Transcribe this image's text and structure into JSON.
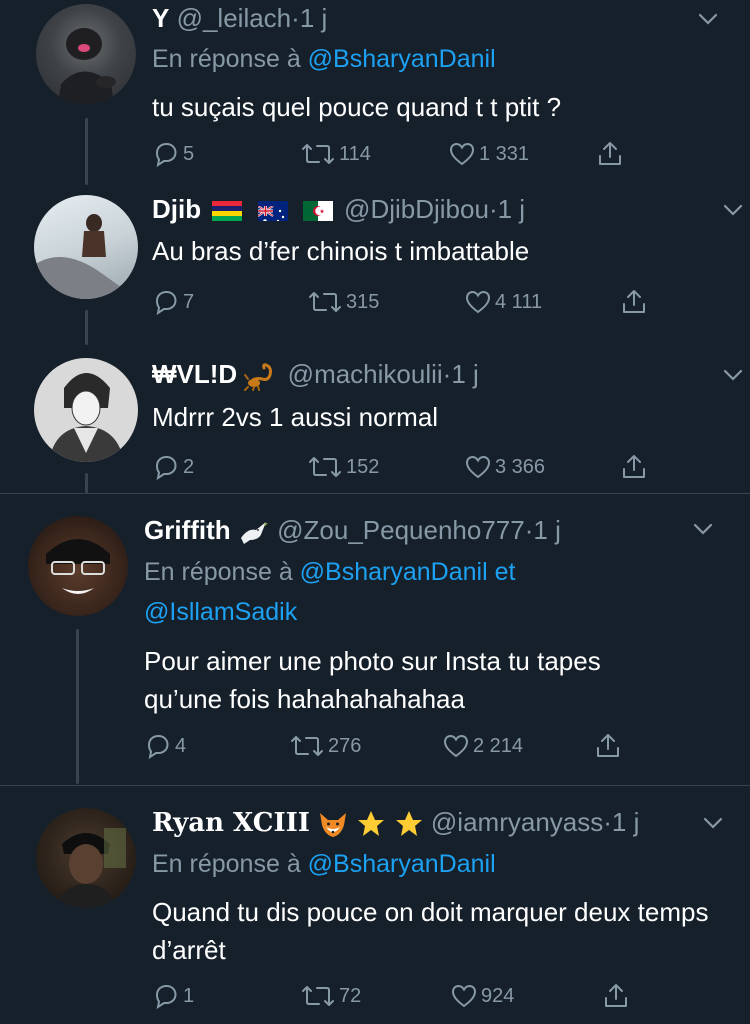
{
  "tweets": [
    {
      "name": "Y",
      "handle": "@_leilach",
      "time": "1 j",
      "reply_prefix": "En réponse à",
      "reply_mention": "@BsharyanDanil",
      "text": "tu suçais quel pouce  quand t t ptit ?",
      "replies": "5",
      "retweets": "114",
      "likes": "1 331"
    },
    {
      "name": "Djib",
      "handle": "@DjibDjibou",
      "time": "1 j",
      "text": "Au bras d’fer chinois t imbattable",
      "replies": "7",
      "retweets": "315",
      "likes": "4 111",
      "flags": [
        "mauritius-flag",
        "australia-flag",
        "algeria-flag"
      ]
    },
    {
      "name": "₩VL!D",
      "handle": "@machikoulii",
      "time": "1 j",
      "text": "Mdrrr 2vs 1 aussi normal",
      "replies": "2",
      "retweets": "152",
      "likes": "3 366",
      "emoji": "scorpion-icon"
    },
    {
      "name": "Griffith",
      "handle": "@Zou_Pequenho777",
      "time": "1 j",
      "reply_prefix": "En réponse à",
      "reply_mention": "@BsharyanDanil et",
      "reply_mention2": "@IsllamSadik",
      "text": "Pour aimer une photo sur Insta tu tapes qu’une fois hahahahahahaa",
      "replies": "4",
      "retweets": "276",
      "likes": "2 214",
      "emoji": "dove-icon"
    },
    {
      "name": "Ryan XCIII",
      "handle": "@iamryanyass",
      "time": "1 j",
      "reply_prefix": "En réponse à",
      "reply_mention": "@BsharyanDanil",
      "text": "Quand tu dis pouce on doit marquer deux temps d’arrêt",
      "replies": "1",
      "retweets": "72",
      "likes": "924",
      "emoji": [
        "fox-icon",
        "star-icon",
        "star-icon"
      ]
    }
  ],
  "separator": "·",
  "colors": {
    "background": "#15202b",
    "text": "#ffffff",
    "muted": "#8899a6",
    "link": "#1da1f2",
    "divider": "#38444d"
  }
}
